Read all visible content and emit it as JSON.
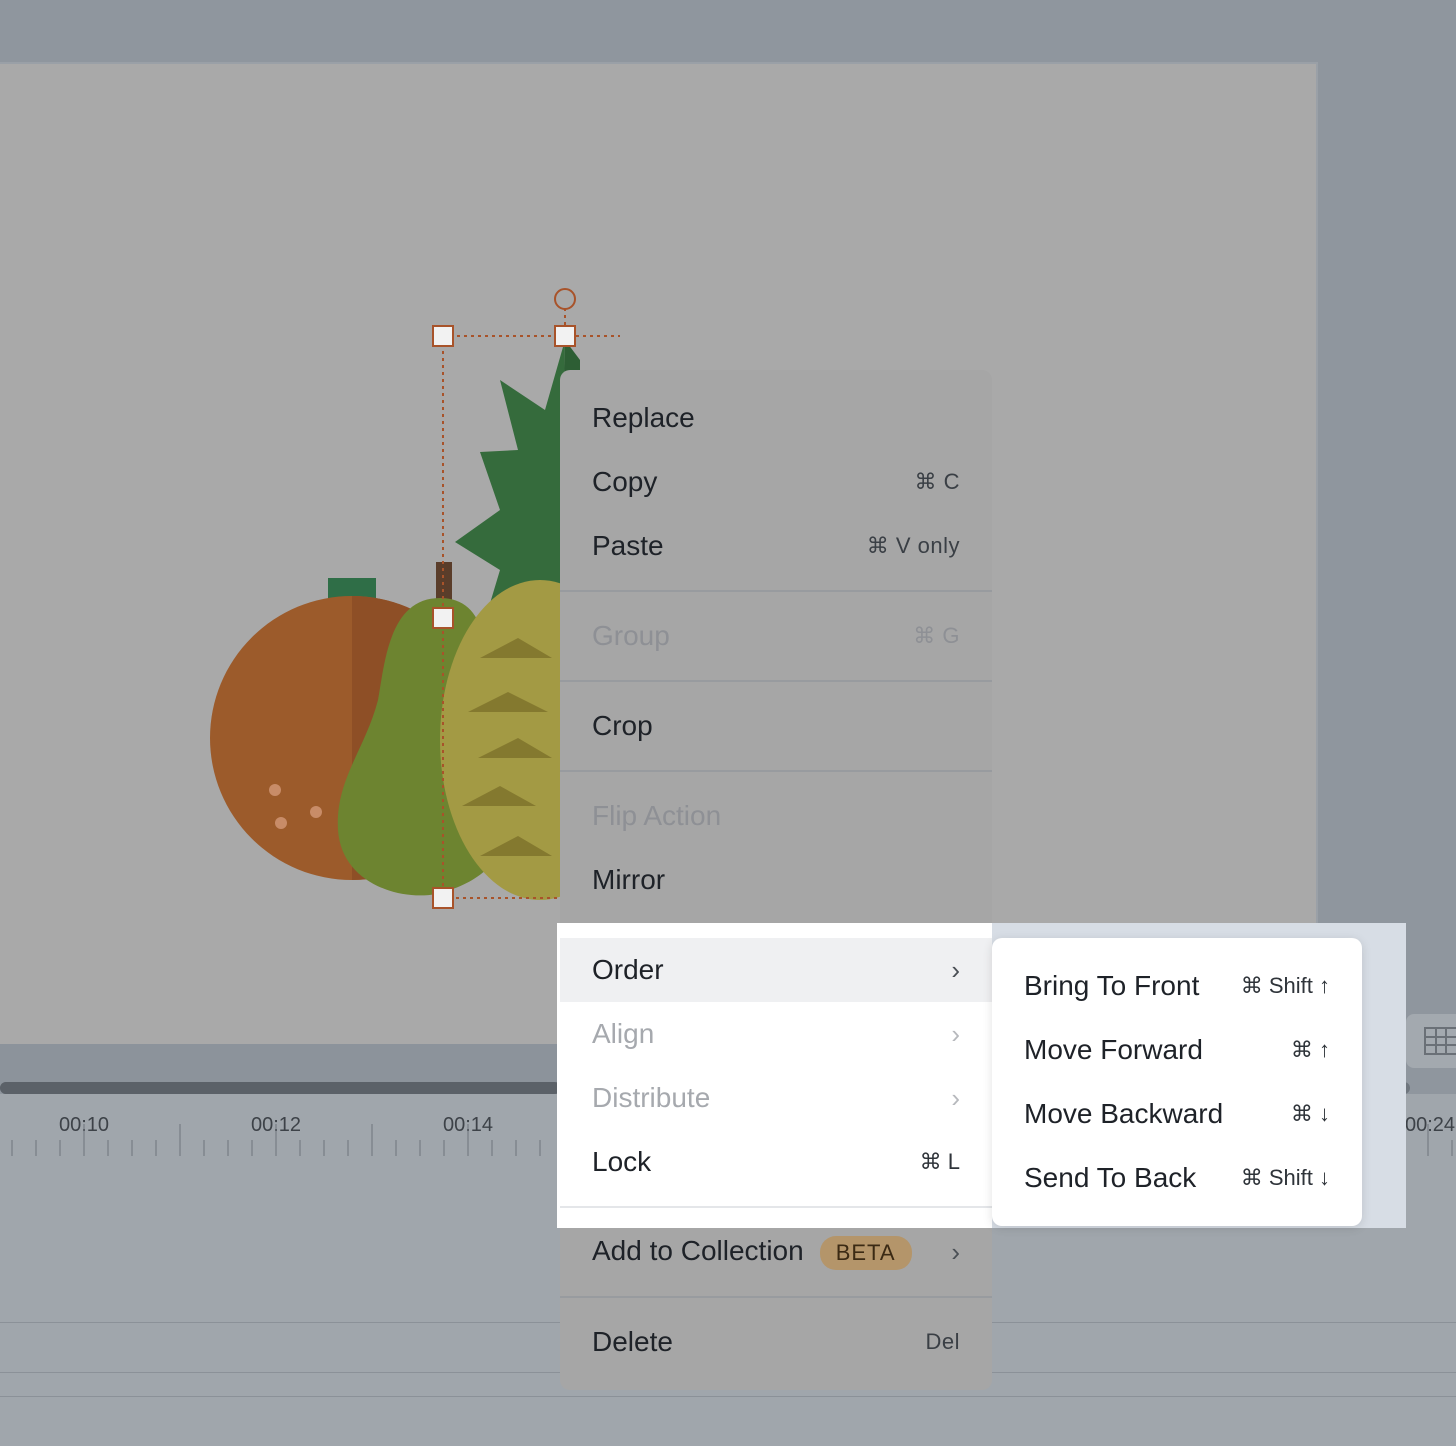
{
  "context_menu": {
    "items": {
      "replace": {
        "label": "Replace"
      },
      "copy": {
        "label": "Copy",
        "shortcut": "⌘ C"
      },
      "paste": {
        "label": "Paste",
        "shortcut": "⌘ V only"
      },
      "group": {
        "label": "Group",
        "shortcut": "⌘ G",
        "disabled": true
      },
      "crop": {
        "label": "Crop"
      },
      "flip_action": {
        "label": "Flip Action",
        "disabled": true
      },
      "mirror": {
        "label": "Mirror"
      },
      "order": {
        "label": "Order",
        "active": true
      },
      "align": {
        "label": "Align",
        "disabled": true
      },
      "distribute": {
        "label": "Distribute",
        "disabled": true
      },
      "lock": {
        "label": "Lock",
        "shortcut": "⌘ L"
      },
      "add_to_collection": {
        "label": "Add to Collection",
        "badge": "BETA"
      },
      "delete": {
        "label": "Delete",
        "shortcut": "Del"
      }
    }
  },
  "order_submenu": {
    "items": [
      {
        "label": "Bring To Front",
        "shortcut": "⌘ Shift ↑"
      },
      {
        "label": "Move Forward",
        "shortcut": "⌘ ↑"
      },
      {
        "label": "Move Backward",
        "shortcut": "⌘ ↓"
      },
      {
        "label": "Send To Back",
        "shortcut": "⌘ Shift ↓"
      }
    ]
  },
  "timeline": {
    "tick_labels": [
      "00:10",
      "00:12",
      "00:14",
      "00:24"
    ]
  },
  "icons": {
    "chevron": "chevron-right-icon",
    "grid": "grid-icon"
  },
  "colors": {
    "selection": "#a8532a",
    "beta_badge": "#b4956a",
    "highlight": "#ffffff"
  }
}
